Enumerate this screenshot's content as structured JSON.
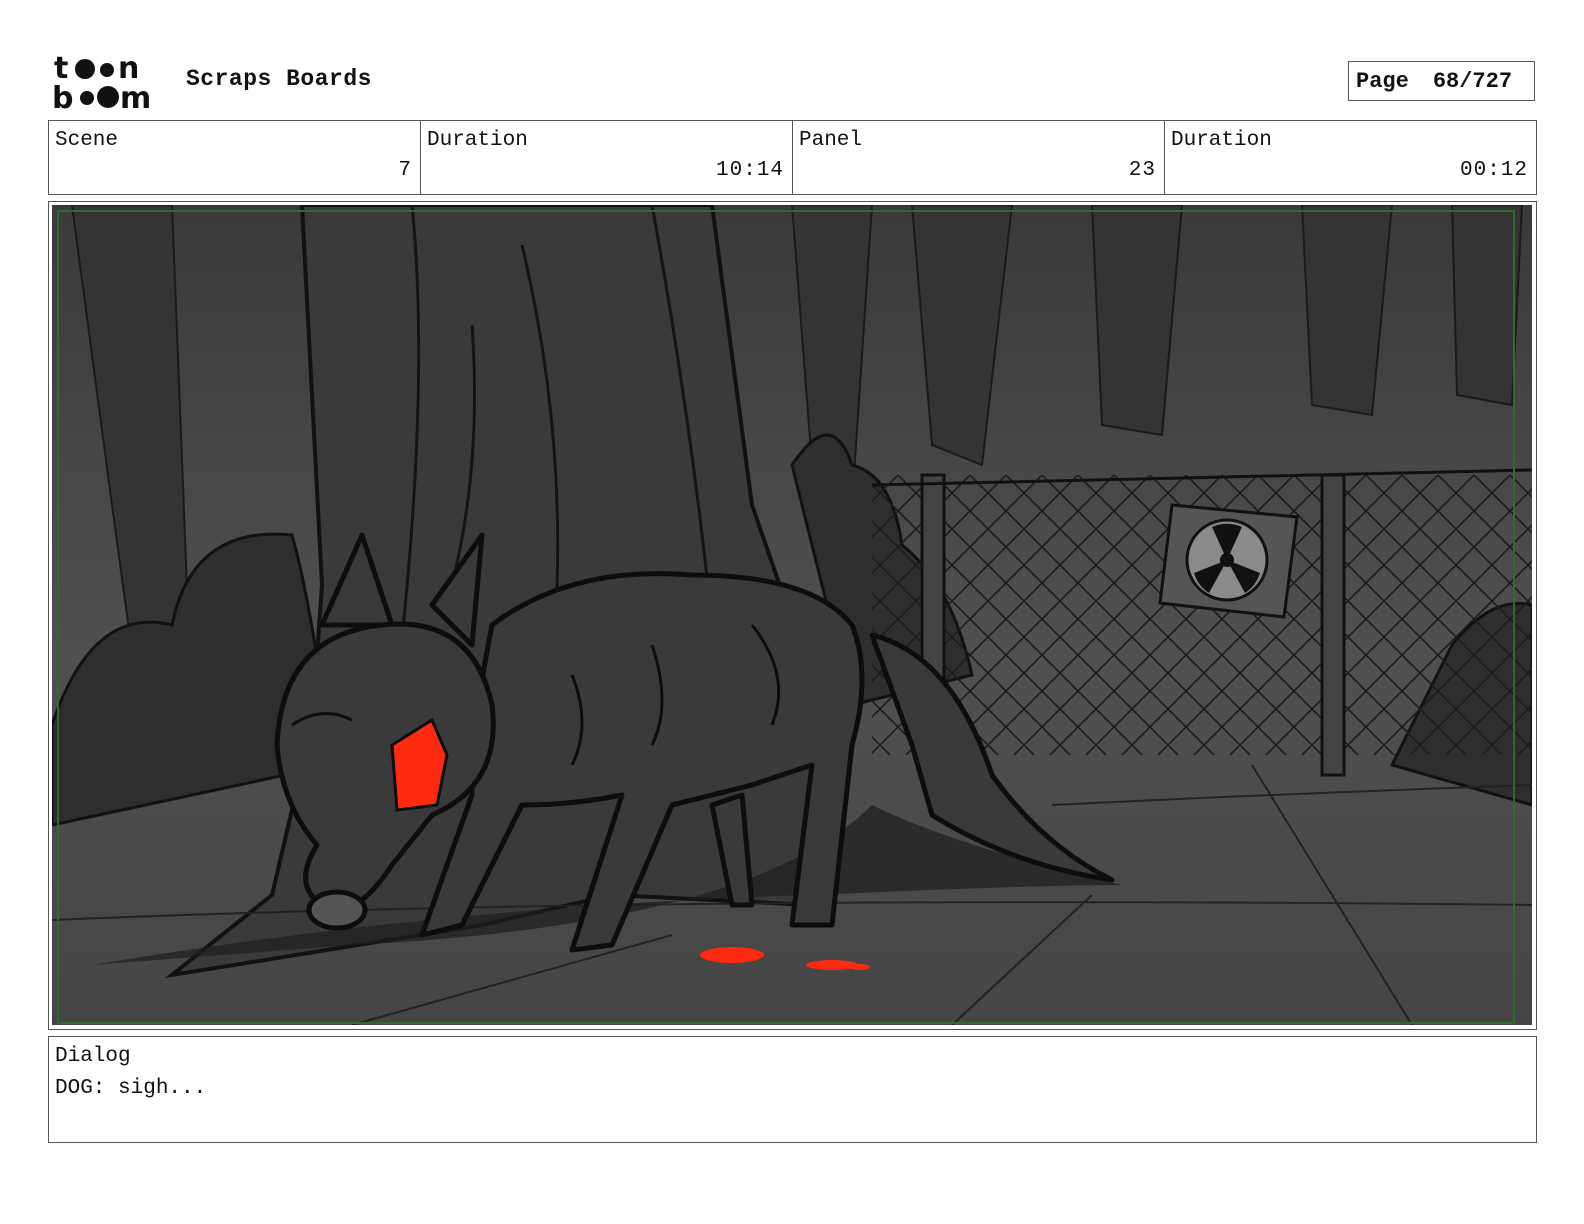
{
  "header": {
    "logo_text": "toonboom",
    "project_title": "Scraps Boards",
    "page_label": "Page",
    "page_value": "68/727"
  },
  "info": {
    "scene_label": "Scene",
    "scene_value": "7",
    "scene_duration_label": "Duration",
    "scene_duration_value": "10:14",
    "panel_label": "Panel",
    "panel_value": "23",
    "panel_duration_label": "Duration",
    "panel_duration_value": "00:12"
  },
  "dialog": {
    "label": "Dialog",
    "text": "DOG: sigh..."
  },
  "colors": {
    "frame_border": "#555555",
    "safe_area": "#2f6b2f",
    "accent_red": "#ff2a12",
    "scene_fill": "#3e3e3e"
  }
}
